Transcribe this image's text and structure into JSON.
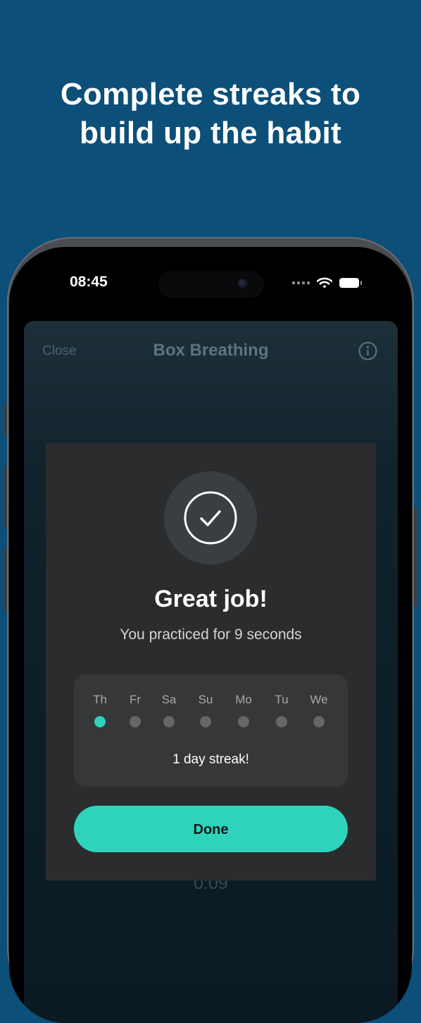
{
  "headline": {
    "line1": "Complete streaks to",
    "line2": "build up the habit"
  },
  "status_bar": {
    "time": "08:45"
  },
  "sheet": {
    "close_label": "Close",
    "title": "Box Breathing",
    "timer": "0:09"
  },
  "completion": {
    "title": "Great job!",
    "subtitle": "You practiced for 9 seconds",
    "days": [
      {
        "label": "Th",
        "completed": true
      },
      {
        "label": "Fr",
        "completed": false
      },
      {
        "label": "Sa",
        "completed": false
      },
      {
        "label": "Su",
        "completed": false
      },
      {
        "label": "Mo",
        "completed": false
      },
      {
        "label": "Tu",
        "completed": false
      },
      {
        "label": "We",
        "completed": false
      }
    ],
    "streak_text": "1 day streak!",
    "done_label": "Done"
  },
  "colors": {
    "background": "#0c4f78",
    "accent": "#2fd3bc",
    "card": "#2a2c2e"
  },
  "icons": {
    "check": "check-circle-icon",
    "info": "info-icon",
    "wifi": "wifi-icon",
    "battery": "battery-icon"
  }
}
